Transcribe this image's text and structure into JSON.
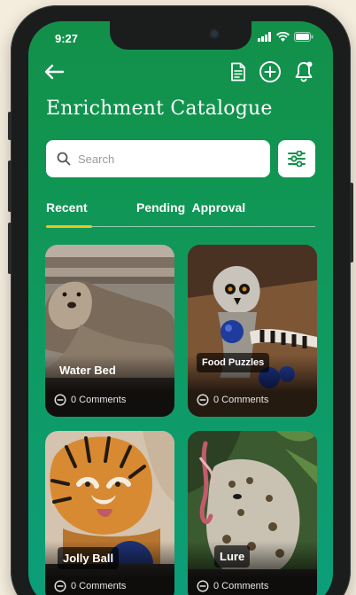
{
  "status": {
    "time": "9:27"
  },
  "header": {
    "title": "Enrichment Catalogue"
  },
  "search": {
    "placeholder": "Search"
  },
  "tabs": [
    {
      "label": "Recent",
      "active": true
    },
    {
      "label": "Pending  Approval",
      "active": false
    }
  ],
  "cards": [
    {
      "label": "Water Bed",
      "comments": "0 Comments"
    },
    {
      "label": "Food Puzzles",
      "comments": "0 Comments"
    },
    {
      "label": "Jolly Ball",
      "comments": "0 Comments"
    },
    {
      "label": "Lure",
      "comments": "0 Comments"
    }
  ],
  "colors": {
    "accent": "#f2c31c",
    "brand": "#12904a"
  },
  "icons": [
    "back-arrow-icon",
    "document-icon",
    "add-circle-icon",
    "bell-icon",
    "search-icon",
    "filter-sliders-icon",
    "comment-icon"
  ]
}
